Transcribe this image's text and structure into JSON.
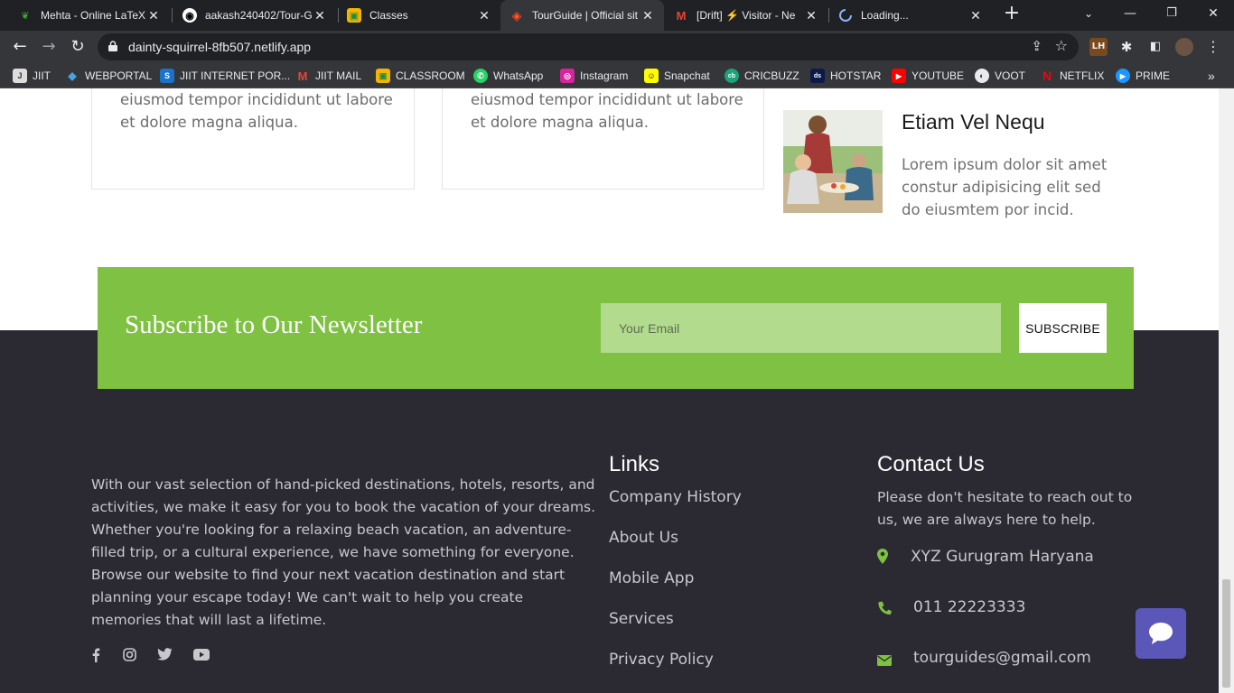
{
  "tabs": [
    {
      "title": "Mehta - Online LaTeX",
      "icon": "overleaf-icon"
    },
    {
      "title": "aakash240402/Tour-G",
      "icon": "github-icon"
    },
    {
      "title": "Classes",
      "icon": "classroom-icon"
    },
    {
      "title": "TourGuide | Official sit",
      "icon": "brave-icon",
      "active": true
    },
    {
      "title": "[Drift] ⚡ Visitor - Ne",
      "icon": "gmail-icon"
    },
    {
      "title": "Loading...",
      "icon": "loading-icon"
    }
  ],
  "address_bar": {
    "url": "dainty-squirrel-8fb507.netlify.app"
  },
  "bookmarks": [
    {
      "label": "JIIT",
      "icon": "jiit-icon"
    },
    {
      "label": "WEBPORTAL",
      "icon": "webportal-icon"
    },
    {
      "label": "JIIT INTERNET POR...",
      "icon": "sophos-icon"
    },
    {
      "label": "JIIT MAIL",
      "icon": "gmail-icon"
    },
    {
      "label": "CLASSROOM",
      "icon": "classroom-icon"
    },
    {
      "label": "WhatsApp",
      "icon": "whatsapp-icon"
    },
    {
      "label": "Instagram",
      "icon": "instagram-icon"
    },
    {
      "label": "Snapchat",
      "icon": "snapchat-icon"
    },
    {
      "label": "CRICBUZZ",
      "icon": "cricbuzz-icon"
    },
    {
      "label": "HOTSTAR",
      "icon": "hotstar-icon"
    },
    {
      "label": "YOUTUBE",
      "icon": "youtube-icon"
    },
    {
      "label": "VOOT",
      "icon": "voot-icon"
    },
    {
      "label": "NETFLIX",
      "icon": "netflix-icon"
    },
    {
      "label": "PRIME",
      "icon": "prime-icon"
    }
  ],
  "cards": [
    {
      "text": "eiusmod tempor incididunt ut labore et dolore magna aliqua."
    },
    {
      "text": "eiusmod tempor incididunt ut labore et dolore magna aliqua."
    }
  ],
  "recent_post": {
    "title": "Etiam Vel Nequ",
    "text": "Lorem ipsum dolor sit amet constur adipisicing elit sed do eiusmtem por incid."
  },
  "newsletter": {
    "heading": "Subscribe to Our Newsletter",
    "placeholder": "Your Email",
    "button": "SUBSCRIBE"
  },
  "footer": {
    "about": "With our vast selection of hand-picked destinations, hotels, resorts, and activities, we make it easy for you to book the vacation of your dreams. Whether you're looking for a relaxing beach vacation, an adventure-filled trip, or a cultural experience, we have something for everyone. Browse our website to find your next vacation destination and start planning your escape today! We can't wait to help you create memories that will last a lifetime.",
    "social": [
      "facebook-icon",
      "instagram-icon",
      "twitter-icon",
      "youtube-icon"
    ],
    "links_title": "Links",
    "links": [
      "Company History",
      "About Us",
      "Mobile App",
      "Services",
      "Privacy Policy"
    ],
    "contact_title": "Contact Us",
    "contact_text": "Please don't hesitate to reach out to us, we are always here to help.",
    "address": "XYZ Gurugram Haryana",
    "phone": "011 22223333",
    "email": "tourguides@gmail.com"
  },
  "colors": {
    "accent": "#7fc142",
    "footer_bg": "#2b2a33",
    "chat": "#5b57b8",
    "input_bg": "#b3db8d"
  }
}
